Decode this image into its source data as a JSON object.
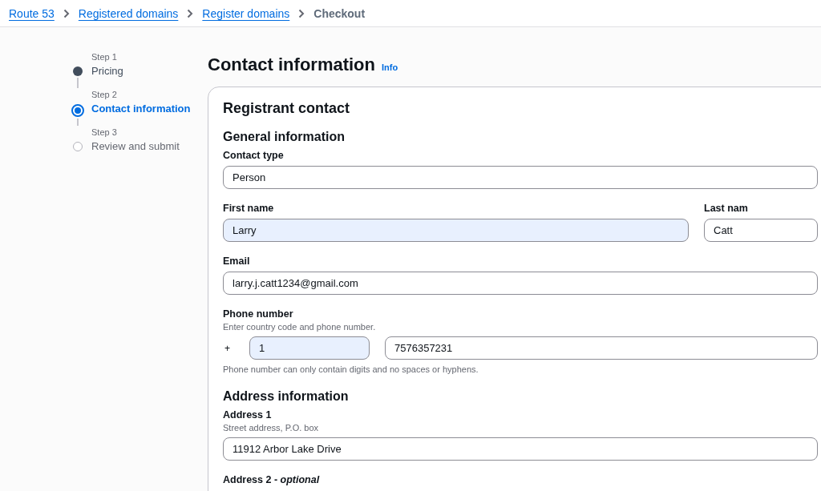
{
  "breadcrumbs": [
    {
      "label": "Route 53",
      "kind": "link"
    },
    {
      "label": "Registered domains",
      "kind": "link"
    },
    {
      "label": "Register domains",
      "kind": "link"
    },
    {
      "label": "Checkout",
      "kind": "current"
    }
  ],
  "steps": [
    {
      "step": "Step 1",
      "label": "Pricing",
      "completed": true,
      "selected": false
    },
    {
      "step": "Step 2",
      "label": "Contact information",
      "completed": false,
      "selected": true
    },
    {
      "step": "Step 3",
      "label": "Review and submit",
      "completed": false,
      "selected": false
    }
  ],
  "page": {
    "title": "Contact information",
    "info": "Info"
  },
  "form": {
    "title": "Registrant contact",
    "groups": [
      {
        "title": "General information",
        "fields": [
          {
            "kind": "text",
            "label": "Contact type",
            "value": "Person",
            "autofilled": false
          },
          {
            "kind": "split",
            "parts": [
              {
                "label": "First name",
                "value": "Larry",
                "autofilled": true
              },
              {
                "label": "Last nam",
                "value": "Catt",
                "autofilled": false
              }
            ]
          },
          {
            "kind": "text",
            "label": "Email",
            "value": "larry.j.catt1234@gmail.com",
            "autofilled": false
          },
          {
            "kind": "phone",
            "label": "Phone number",
            "description": "Enter country code and phone number.",
            "prefix": "+",
            "code": {
              "value": "1",
              "autofilled": true
            },
            "number": {
              "value": "7576357231",
              "autofilled": false
            },
            "constraint": "Phone number can only contain digits and no spaces or hyphens."
          }
        ]
      },
      {
        "title": "Address information",
        "fields": [
          {
            "kind": "text",
            "label": "Address 1",
            "description": "Street address, P.O. box",
            "value": "11912 Arbor Lake Drive",
            "autofilled": false
          },
          {
            "kind": "label",
            "label": "Address 2 - *optional*"
          }
        ]
      }
    ]
  }
}
